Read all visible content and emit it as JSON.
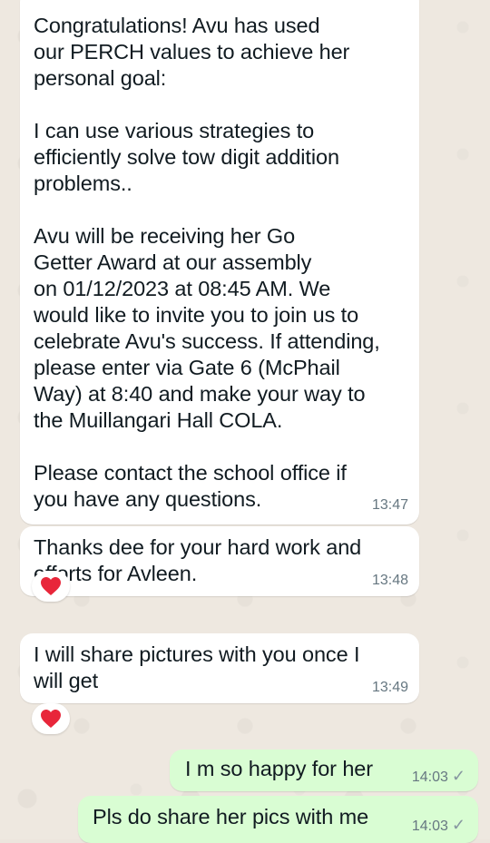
{
  "chat": {
    "messages": [
      {
        "direction": "incoming",
        "text": "Congratulations! Avu has used\nour PERCH values to achieve her\npersonal goal:\n\nI can use various strategies to\nefficiently solve tow digit addition\nproblems..\n\nAvu will be receiving her Go\nGetter Award at our assembly\non 01/12/2023 at 08:45 AM. We\nwould like to invite you to join us to\ncelebrate Avu's success. If attending,\nplease enter via Gate 6 (McPhail\nWay) at 8:40 and make your way to\nthe Muillangari Hall COLA.\n\nPlease contact the school office if\nyou have any questions.",
        "time": "13:47"
      },
      {
        "direction": "incoming",
        "text": "Thanks dee for your hard work and\nefforts for Avleen.",
        "time": "13:48",
        "reaction_icon": "red-heart-icon"
      },
      {
        "direction": "incoming",
        "text": "I will share pictures with you once I\nwill get",
        "time": "13:49",
        "reaction_icon": "red-heart-icon"
      },
      {
        "direction": "outgoing",
        "text": "I m so happy for her",
        "time": "14:03",
        "status_icon": "single-check-icon"
      },
      {
        "direction": "outgoing",
        "text": "Pls do share her pics with me",
        "time": "14:03",
        "status_icon": "single-check-icon"
      }
    ]
  },
  "colors": {
    "incoming_bubble": "#ffffff",
    "outgoing_bubble": "#d9fdd3",
    "timestamp": "#667781",
    "heart": "#e8263a"
  }
}
